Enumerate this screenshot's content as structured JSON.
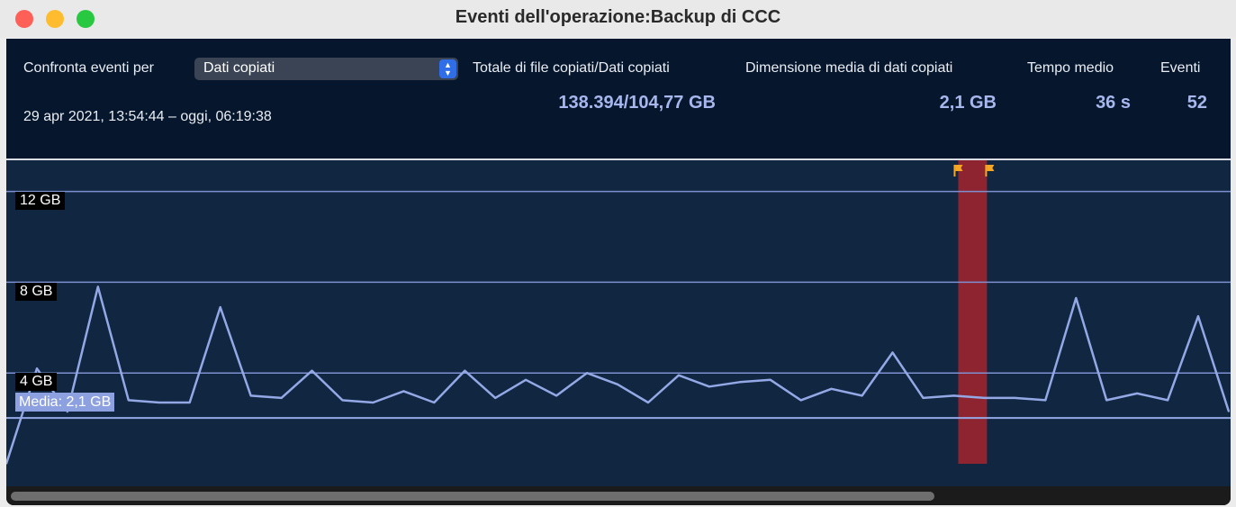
{
  "window": {
    "title": "Eventi dell'operazione:Backup di CCC"
  },
  "header": {
    "compare_label": "Confronta eventi per",
    "compare_select": {
      "value": "Dati copiati",
      "icon": "updown-chevron-icon"
    },
    "date_range": "29 apr 2021, 13:54:44 – oggi, 06:19:38",
    "stats": [
      {
        "label": "Totale di file copiati/Dati copiati",
        "value": "138.394/104,77 GB"
      },
      {
        "label": "Dimensione media di dati copiati",
        "value": "2,1 GB"
      },
      {
        "label": "Tempo medio",
        "value": "36 s"
      },
      {
        "label": "Eventi",
        "value": "52"
      }
    ]
  },
  "chart_data": {
    "type": "line",
    "series": [
      {
        "values": [
          0.0,
          4.2,
          2.3,
          7.8,
          2.8,
          2.7,
          2.7,
          6.9,
          3.0,
          2.9,
          4.1,
          2.8,
          2.7,
          3.2,
          2.7,
          4.1,
          2.9,
          3.7,
          3.0,
          4.0,
          3.5,
          2.7,
          3.9,
          3.4,
          3.6,
          3.7,
          2.8,
          3.3,
          3.0,
          4.9,
          2.9,
          3.0,
          2.9,
          2.9,
          2.8,
          7.3,
          2.8,
          3.1,
          2.8,
          6.5,
          2.3
        ]
      }
    ],
    "y_ticks": [
      "4 GB",
      "8 GB",
      "12 GB"
    ],
    "y_tick_values": [
      4,
      8,
      12
    ],
    "ylim": [
      0,
      13.3
    ],
    "average": {
      "label": "Media: 2,1 GB",
      "value": 2.1
    },
    "highlight": {
      "marker_icon": "flag-icon",
      "start_index": 31,
      "end_index": 32,
      "color": "#8e2430"
    },
    "colors": {
      "line": "#94a8e6",
      "grid": "#7e90d0",
      "background": "#102641",
      "flag": "#f5a623"
    }
  },
  "scrollbar": {
    "position": 0.0
  }
}
